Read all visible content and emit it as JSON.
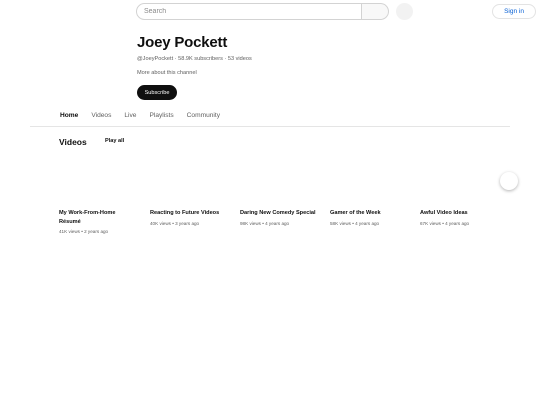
{
  "header": {
    "search_placeholder": "Search",
    "signin_label": "Sign in"
  },
  "channel": {
    "name": "Joey Pockett",
    "meta": "@JoeyPockett · 58.9K subscribers · 53 videos",
    "about": "More about this channel",
    "subscribe_label": "Subscribe"
  },
  "tabs": [
    {
      "label": "Home",
      "active": true
    },
    {
      "label": "Videos"
    },
    {
      "label": "Live"
    },
    {
      "label": "Playlists"
    },
    {
      "label": "Community"
    }
  ],
  "section": {
    "title": "Videos",
    "play_all": "Play all"
  },
  "videos": [
    {
      "title": "My Work-From-Home Résumé",
      "meta": "41K views • 2 years ago"
    },
    {
      "title": "Reacting to Future Videos",
      "meta": "40K views • 3 years ago"
    },
    {
      "title": "Daring New Comedy Special",
      "meta": "98K views • 4 years ago"
    },
    {
      "title": "Gamer of the Week",
      "meta": "58K views • 4 years ago"
    },
    {
      "title": "Awful Video Ideas",
      "meta": "67K views • 4 years ago"
    }
  ]
}
